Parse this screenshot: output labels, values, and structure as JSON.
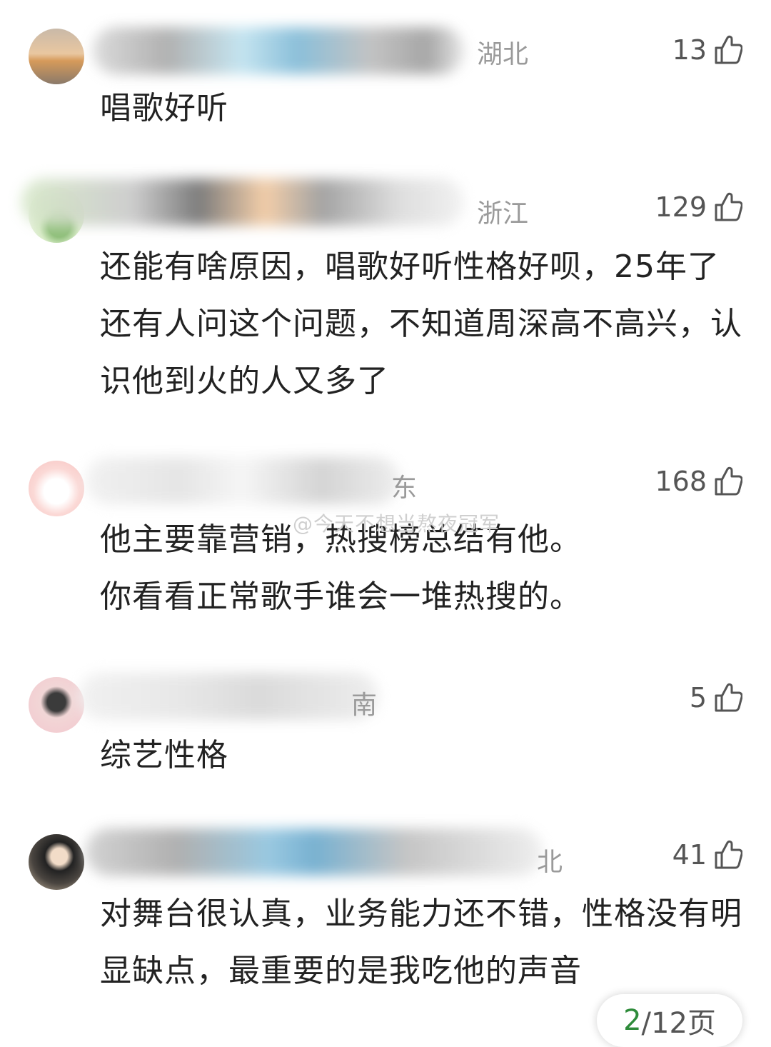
{
  "comments": [
    {
      "region": "湖北",
      "likes": "13",
      "text": "唱歌好听"
    },
    {
      "region": "浙江",
      "likes": "129",
      "text": "还能有啥原因，唱歌好听性格好呗，25年了还有人问这个问题，不知道周深高不高兴，认识他到火的人又多了"
    },
    {
      "region": "东",
      "likes": "168",
      "text_lines": [
        "他主要靠营销，热搜榜总结有他。",
        "你看看正常歌手谁会一堆热搜的。"
      ]
    },
    {
      "region": "南",
      "likes": "5",
      "text": "综艺性格"
    },
    {
      "region": "北",
      "likes": "41",
      "text": "对舞台很认真，业务能力还不错，性格没有明显缺点，最重要的是我吃他的声音"
    }
  ],
  "watermark": "@今天不想当熬夜冠军",
  "pager": {
    "current": "2",
    "total": "/12页"
  },
  "icons": {
    "like": "thumbs-up-icon"
  },
  "colors": {
    "accent_green": "#2e8b3a",
    "region_gray": "#9a9a9a"
  }
}
